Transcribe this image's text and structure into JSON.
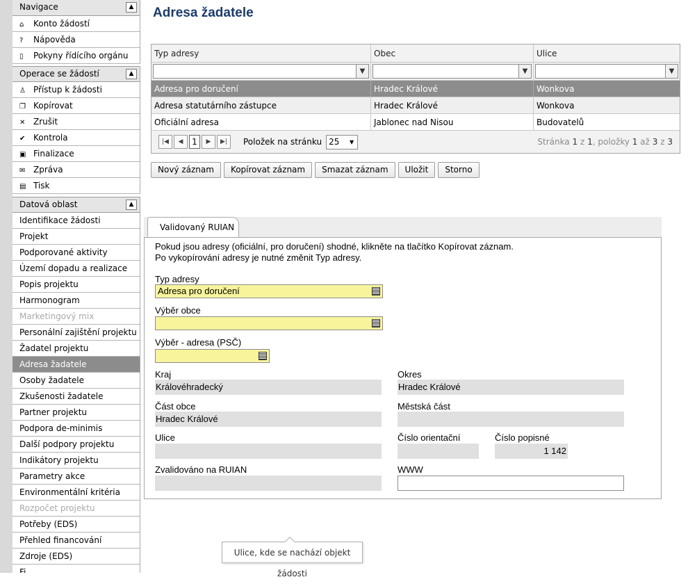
{
  "sidebar": {
    "navigace": {
      "title": "Navigace",
      "items": [
        {
          "icon": "home-icon",
          "glyph": "⌂",
          "label": "Konto žádostí"
        },
        {
          "icon": "help-icon",
          "glyph": "?",
          "label": "Nápověda"
        },
        {
          "icon": "book-icon",
          "glyph": "▯",
          "label": "Pokyny řídícího orgánu"
        }
      ]
    },
    "operace": {
      "title": "Operace se žádostí",
      "items": [
        {
          "icon": "user-icon",
          "glyph": "♙",
          "label": "Přístup k žádosti"
        },
        {
          "icon": "copy-icon",
          "glyph": "❐",
          "label": "Kopírovat"
        },
        {
          "icon": "cancel-icon",
          "glyph": "✕",
          "label": "Zrušit"
        },
        {
          "icon": "check-icon",
          "glyph": "✔",
          "label": "Kontrola"
        },
        {
          "icon": "lock-icon",
          "glyph": "▣",
          "label": "Finalizace"
        },
        {
          "icon": "mail-icon",
          "glyph": "✉",
          "label": "Zpráva"
        },
        {
          "icon": "print-icon",
          "glyph": "▤",
          "label": "Tisk"
        }
      ]
    },
    "datova": {
      "title": "Datová oblast",
      "items": [
        {
          "label": "Identifikace žádosti",
          "state": ""
        },
        {
          "label": "Projekt",
          "state": ""
        },
        {
          "label": "Podporované aktivity",
          "state": ""
        },
        {
          "label": "Území dopadu a realizace",
          "state": ""
        },
        {
          "label": "Popis projektu",
          "state": ""
        },
        {
          "label": "Harmonogram",
          "state": ""
        },
        {
          "label": "Marketingový mix",
          "state": "disabled"
        },
        {
          "label": "Personální zajištění projektu",
          "state": ""
        },
        {
          "label": "Žadatel projektu",
          "state": ""
        },
        {
          "label": "Adresa žadatele",
          "state": "active"
        },
        {
          "label": "Osoby žadatele",
          "state": ""
        },
        {
          "label": "Zkušenosti žadatele",
          "state": ""
        },
        {
          "label": "Partner projektu",
          "state": ""
        },
        {
          "label": "Podpora de-minimis",
          "state": ""
        },
        {
          "label": "Další podpory projektu",
          "state": ""
        },
        {
          "label": "Indikátory projektu",
          "state": ""
        },
        {
          "label": "Parametry akce",
          "state": ""
        },
        {
          "label": "Environmentální kritéria",
          "state": ""
        },
        {
          "label": "Rozpočet projektu",
          "state": "disabled"
        },
        {
          "label": "Potřeby (EDS)",
          "state": ""
        },
        {
          "label": "Přehled financování",
          "state": ""
        },
        {
          "label": "Zdroje (EDS)",
          "state": ""
        },
        {
          "label": "Fi...",
          "state": ""
        }
      ]
    }
  },
  "page": {
    "title": "Adresa žadatele"
  },
  "grid": {
    "columns": [
      "Typ adresy",
      "Obec",
      "Ulice"
    ],
    "rows": [
      [
        "Adresa pro doručení",
        "Hradec Králové",
        "Wonkova"
      ],
      [
        "Adresa statutárního zástupce",
        "Hradec Králové",
        "Wonkova"
      ],
      [
        "Oficiální adresa",
        "Jablonec nad Nisou",
        "Budovatelů"
      ]
    ],
    "selected_row": 0,
    "pager": {
      "page": "1",
      "per_page_label": "Položek na stránku",
      "per_page": "25",
      "info_prefix": "Stránka",
      "page_cur": "1",
      "of": "z",
      "page_total": "1",
      "items_word": "položky",
      "item_from": "1",
      "to": "až",
      "item_to": "3",
      "item_total": "3"
    }
  },
  "actions": {
    "new": "Nový záznam",
    "copy": "Kopírovat záznam",
    "delete": "Smazat záznam",
    "save": "Uložit",
    "cancel": "Storno"
  },
  "tab": {
    "label": "Validovaný RUIAN"
  },
  "form": {
    "info_line1": "Pokud jsou adresy (oficiální, pro doručení) shodné, klikněte na tlačítko Kopírovat záznam.",
    "info_line2": "Po vykopírování adresy je nutné změnit Typ adresy.",
    "typ_adresy_label": "Typ adresy",
    "typ_adresy_value": "Adresa pro doručení",
    "vyber_obce_label": "Výběr obce",
    "vyber_obce_value": "",
    "vyber_adresa_label": "Výběr - adresa (PSČ)",
    "vyber_adresa_value": "",
    "kraj_label": "Kraj",
    "kraj_value": "Královéhradecký",
    "okres_label": "Okres",
    "okres_value": "Hradec Králové",
    "cast_obce_label": "Část obce",
    "cast_obce_value": "Hradec Králové",
    "mestska_cast_label": "Městská část",
    "mestska_cast_value": "",
    "ulice_label": "Ulice",
    "ulice_value": "",
    "cislo_orient_label": "Číslo orientační",
    "cislo_orient_value": "",
    "cislo_pop_label": "Číslo popisné",
    "cislo_pop_value": "1 142",
    "zvalidovano_label": "Zvalidováno na RUIAN",
    "zvalidovano_value": "",
    "www_label": "WWW",
    "www_value": ""
  },
  "tooltip": {
    "text": "Ulice, kde se nachází objekt žádosti"
  }
}
